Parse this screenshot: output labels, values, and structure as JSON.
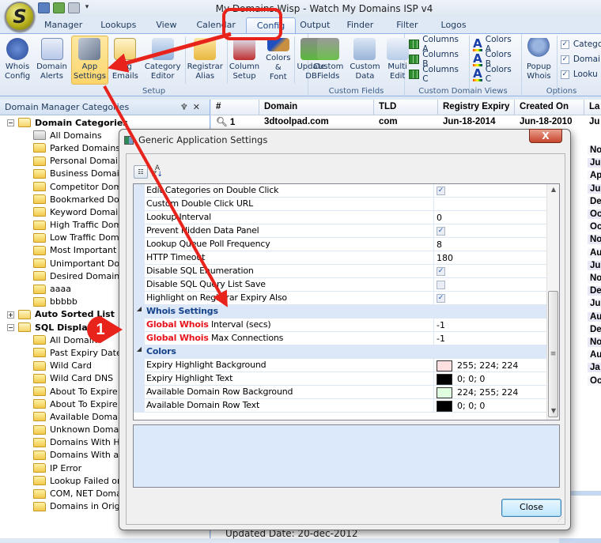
{
  "window": {
    "title": "My Domains.Wisp - Watch My Domains ISP v4",
    "logo_letter": "S"
  },
  "quick_access": [
    "save-icon",
    "new-icon",
    "print-icon",
    "customize-dropdown-icon"
  ],
  "tabs": [
    {
      "label": "Manager"
    },
    {
      "label": "Lookups"
    },
    {
      "label": "View"
    },
    {
      "label": "Calendar"
    },
    {
      "label": "Config",
      "active": true
    },
    {
      "label": "Output"
    },
    {
      "label": "Finder"
    },
    {
      "label": "Filter"
    },
    {
      "label": "Logos"
    }
  ],
  "ribbon": {
    "setup": {
      "label": "Setup",
      "buttons": [
        {
          "l1": "Whois",
          "l2": "Config"
        },
        {
          "l1": "Domain",
          "l2": "Alerts"
        },
        {
          "l1": "App",
          "l2": "Settings"
        },
        {
          "l1": "Tag",
          "l2": "Emails"
        },
        {
          "l1": "Category",
          "l2": "Editor"
        },
        {
          "l1": "Registrar",
          "l2": "Alias"
        },
        {
          "l1": "Column",
          "l2": "Setup"
        },
        {
          "l1": "Colors",
          "l2": "& Font"
        },
        {
          "l1": "Update",
          "l2": "DB"
        }
      ]
    },
    "custom_fields": {
      "label": "Custom Fields",
      "buttons": [
        {
          "l1": "Custom",
          "l2": "Fields"
        },
        {
          "l1": "Custom",
          "l2": "Data"
        },
        {
          "l1": "Multi",
          "l2": "Edit"
        }
      ]
    },
    "custom_views": {
      "label": "Custom Domain Views",
      "columns": [
        "Columns A",
        "Columns B",
        "Columns C"
      ],
      "colors": [
        "Colors A",
        "Colors B",
        "Colors C"
      ]
    },
    "options": {
      "label": "Options",
      "popup": {
        "l1": "Popup",
        "l2": "Whois"
      },
      "checks": [
        {
          "label": "Catego",
          "checked": true
        },
        {
          "label": "Domai",
          "checked": true
        },
        {
          "label": "Looku",
          "checked": true
        }
      ]
    }
  },
  "left_panel": {
    "title": "Domain Manager Categories",
    "pin": "♆",
    "close": "✕",
    "domain_categories": {
      "label": "Domain Categories",
      "items": [
        "All Domains",
        "Parked Domains",
        "Personal Domains",
        "Business Domains",
        "Competitor Domai",
        "Bookmarked Doma",
        "Keyword Domains",
        "High Traffic Doma",
        "Low Traffic Domai",
        "Most Important Do",
        "Unimportant Doma",
        "Desired Domains",
        "aaaa",
        "bbbbb"
      ]
    },
    "auto_sorted": {
      "label": "Auto Sorted List"
    },
    "sql_display": {
      "label": "SQL Display Q",
      "items": [
        "All Domain",
        "Past Expiry Date",
        "Wild Card",
        "Wild Card DNS",
        "About To Expire [R",
        "About To Expire (R",
        "Available Domains",
        "Unknown Domains",
        "Domains With Hyp",
        "Domains With an I",
        "IP Error",
        "Lookup Failed or N",
        "COM, NET Domain",
        "Domains in Origina"
      ]
    }
  },
  "grid": {
    "columns": [
      "#",
      "Domain",
      "TLD",
      "Registry Expiry",
      "Created On",
      "La"
    ],
    "first_row": {
      "num": "1",
      "domain": "3dtoolpad.com",
      "tld": "com",
      "expiry": "Jun-18-2014",
      "created": "Jun-18-2010",
      "last": "Ju"
    },
    "last_col_values": [
      "No",
      "Ju",
      "Ap",
      "Ju",
      "De",
      "Oc",
      "Oc",
      "No",
      "Au",
      "Ju",
      "No",
      "De",
      "Ju",
      "Au",
      "De",
      "No",
      "Au",
      "Ja",
      "Oc"
    ],
    "status_text": "Updated Date: 20-dec-2012"
  },
  "dialog": {
    "title": "Generic Application Settings",
    "close_glyph": "X",
    "toolbar": {
      "categorized": "categorized-view-icon",
      "alphabetical": "sort-alphabetical-icon"
    },
    "rows": [
      {
        "name": "Edit Categories on Double Click",
        "type": "check",
        "value": true
      },
      {
        "name": "Custom Double Click URL",
        "type": "text",
        "value": ""
      },
      {
        "name": "Lookup Interval",
        "type": "text",
        "value": "0"
      },
      {
        "name": "Prevent Hidden Data Panel",
        "type": "check",
        "value": true
      },
      {
        "name": "Lookup Queue Poll Frequency",
        "type": "text",
        "value": "8"
      },
      {
        "name": "HTTP Timeout",
        "type": "text",
        "value": "180"
      },
      {
        "name": "Disable SQL Enumeration",
        "type": "check",
        "value": true
      },
      {
        "name": "Disable SQL Query List Save",
        "type": "check",
        "value": false
      },
      {
        "name": "Highlight on Registrar Expiry Also",
        "type": "check",
        "value": true
      }
    ],
    "whois_category": "Whois Settings",
    "whois_rows": [
      {
        "highlight": "Global Whois",
        "rest": " Interval (secs)",
        "value": "-1"
      },
      {
        "highlight": "Global Whois",
        "rest": " Max Connections",
        "value": "-1"
      }
    ],
    "colors_category": "Colors",
    "color_rows": [
      {
        "name": "Expiry Highlight Background",
        "swatch": "#ffe0e0",
        "value": "255; 224; 224"
      },
      {
        "name": "Expiry Highlight Text",
        "swatch": "#000000",
        "value": "0; 0; 0"
      },
      {
        "name": "Available Domain Row Background",
        "swatch": "#e0ffe0",
        "value": "224; 255; 224"
      },
      {
        "name": "Available Domain Row Text",
        "swatch": "#000000",
        "value": "0; 0; 0"
      }
    ],
    "close_button": "Close"
  },
  "annotations": {
    "step_badge": "1",
    "accent_color": "#e8231b"
  }
}
